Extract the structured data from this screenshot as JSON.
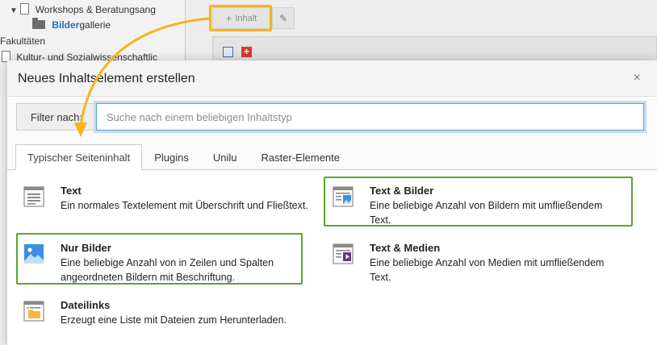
{
  "tree": {
    "items": [
      {
        "label": "Workshops & Beratungsang"
      },
      {
        "label_highlight": "Bilder",
        "label_rest": "gallerie"
      },
      {
        "label": "Fakultäten"
      },
      {
        "label": "Kultur- und Sozialwissenschaftlic"
      }
    ]
  },
  "toolbar": {
    "add_content_label": "Inhalt"
  },
  "modal": {
    "title": "Neues Inhaltselement erstellen",
    "close_label": "×",
    "filter": {
      "label": "Filter nach:",
      "placeholder": "Suche nach einem beliebigen Inhaltstyp",
      "value": ""
    },
    "tabs": [
      {
        "label": "Typischer Seiteninhalt",
        "active": true
      },
      {
        "label": "Plugins",
        "active": false
      },
      {
        "label": "Unilu",
        "active": false
      },
      {
        "label": "Raster-Elemente",
        "active": false
      }
    ],
    "items": [
      {
        "title": "Text",
        "description": "Ein normales Textelement mit Überschrift und Fließtext.",
        "icon": "text-icon"
      },
      {
        "title": "Text & Bilder",
        "description": "Eine beliebige Anzahl von Bildern mit umfließendem Text.",
        "icon": "text-image-icon"
      },
      {
        "title": "Nur Bilder",
        "description": "Eine beliebige Anzahl von in Zeilen und Spalten angeordneten Bildern mit Beschriftung.",
        "icon": "images-icon"
      },
      {
        "title": "Text & Medien",
        "description": "Eine beliebige Anzahl von Medien mit umfließendem Text.",
        "icon": "text-media-icon"
      },
      {
        "title": "Dateilinks",
        "description": "Erzeugt eine Liste mit Dateien zum Herunterladen.",
        "icon": "file-links-icon"
      }
    ]
  },
  "colors": {
    "highlight_orange": "#f6b41a",
    "highlight_green": "#5aa62e",
    "focus_blue": "#5d9ed6",
    "link_blue": "#1f6fb7"
  }
}
